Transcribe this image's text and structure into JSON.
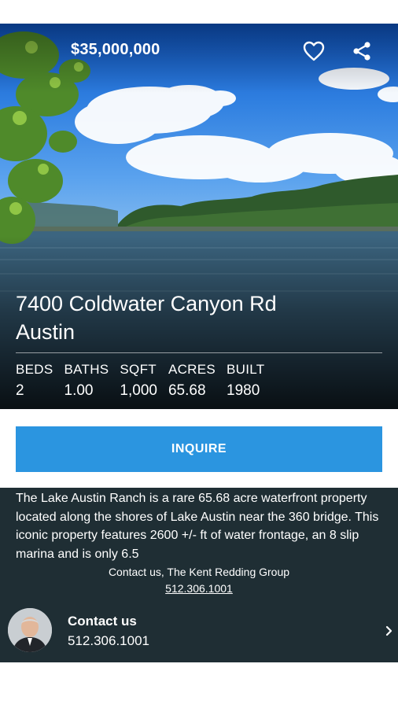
{
  "listing": {
    "price": "$35,000,000",
    "address_line1": "7400 Coldwater Canyon Rd",
    "address_line2": "Austin",
    "stats": [
      {
        "label": "BEDS",
        "value": "2"
      },
      {
        "label": "BATHS",
        "value": "1.00"
      },
      {
        "label": "SQFT",
        "value": "1,000"
      },
      {
        "label": "ACRES",
        "value": "65.68"
      },
      {
        "label": "BUILT",
        "value": "1980"
      }
    ]
  },
  "actions": {
    "inquire_label": "INQUIRE",
    "favorite_icon": "heart-outline-icon",
    "share_icon": "share-icon"
  },
  "description": {
    "text": "The Lake Austin Ranch is a rare 65.68 acre waterfront property located along the shores of Lake Austin near the 360 bridge. This iconic property features 2600 +/- ft of water frontage, an 8 slip marina and is only 6.5"
  },
  "contact": {
    "line": "Contact us, The Kent Redding Group",
    "phone_link": "512.306.1001",
    "card_title": "Contact us",
    "card_phone": "512.306.1001"
  },
  "colors": {
    "accent": "#2b95e0",
    "panel": "#1f2e34"
  }
}
